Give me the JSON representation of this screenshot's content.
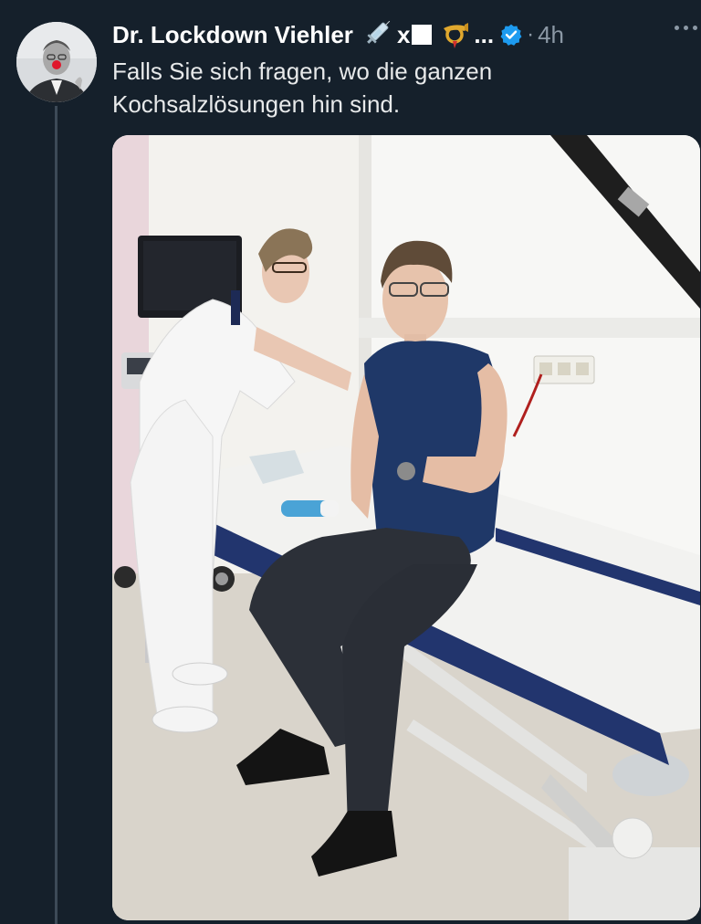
{
  "tweet": {
    "display_name": "Dr. Lockdown Viehler",
    "name_suffix": "x",
    "name_ellipsis": "...",
    "separator": "·",
    "timestamp": "4h",
    "text_line1": "Falls Sie sich fragen, wo die ganzen",
    "text_line2": "Kochsalzlösungen hin sind.",
    "icons": {
      "avatar": "profile-avatar",
      "name_emoji_1": "syringe-icon",
      "name_emoji_2": "postal-horn-icon",
      "verified": "verified-badge-icon",
      "more": "more-options-icon"
    },
    "colors": {
      "background": "#15202b",
      "verified_blue": "#1d9bf0",
      "secondary_text": "#8b98a5"
    }
  },
  "media": {
    "description_type": "photo"
  }
}
